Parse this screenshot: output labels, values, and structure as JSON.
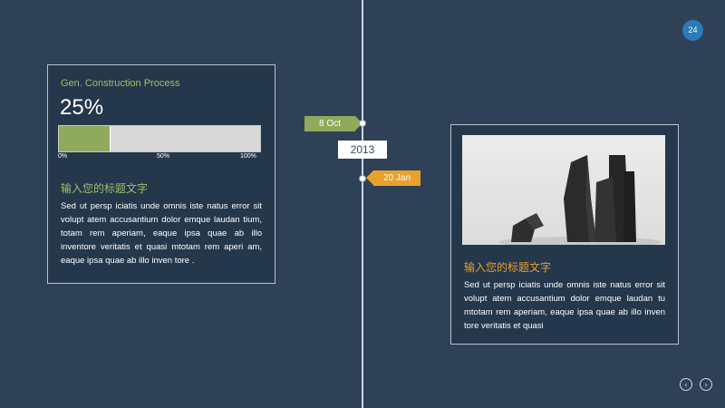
{
  "page_number": "24",
  "timeline": {
    "tag_top": "8 Oct",
    "year": "2013",
    "tag_bottom": "20 Jan"
  },
  "left_card": {
    "caption": "Gen. Construction Process",
    "percent_label": "25%",
    "progress_value": 0.25,
    "ticks": [
      "0%",
      "50%",
      "100%"
    ],
    "heading": "输入您的标题文字",
    "body": "Sed ut persp iciatis unde omnis iste natus error sit volupt atem accusantium dolor emque laudan tium, totam rem aperiam, eaque ipsa quae ab illo inventore veritatis et quasi mtotam rem aperi am, eaque ipsa quae ab illo inven tore ."
  },
  "right_card": {
    "heading": "输入您的标题文字",
    "body": "Sed ut persp iciatis unde omnis iste natus error sit volupt atem accusantium dolor emque laudan tu mtotam rem aperiam, eaque ipsa quae ab illo inven tore veritatis et quasi"
  },
  "nav": {
    "prev": "‹",
    "next": "›"
  },
  "colors": {
    "background": "#2f4157",
    "green": "#8faa5c",
    "orange": "#e8a12c",
    "badge": "#2a7bb8"
  }
}
